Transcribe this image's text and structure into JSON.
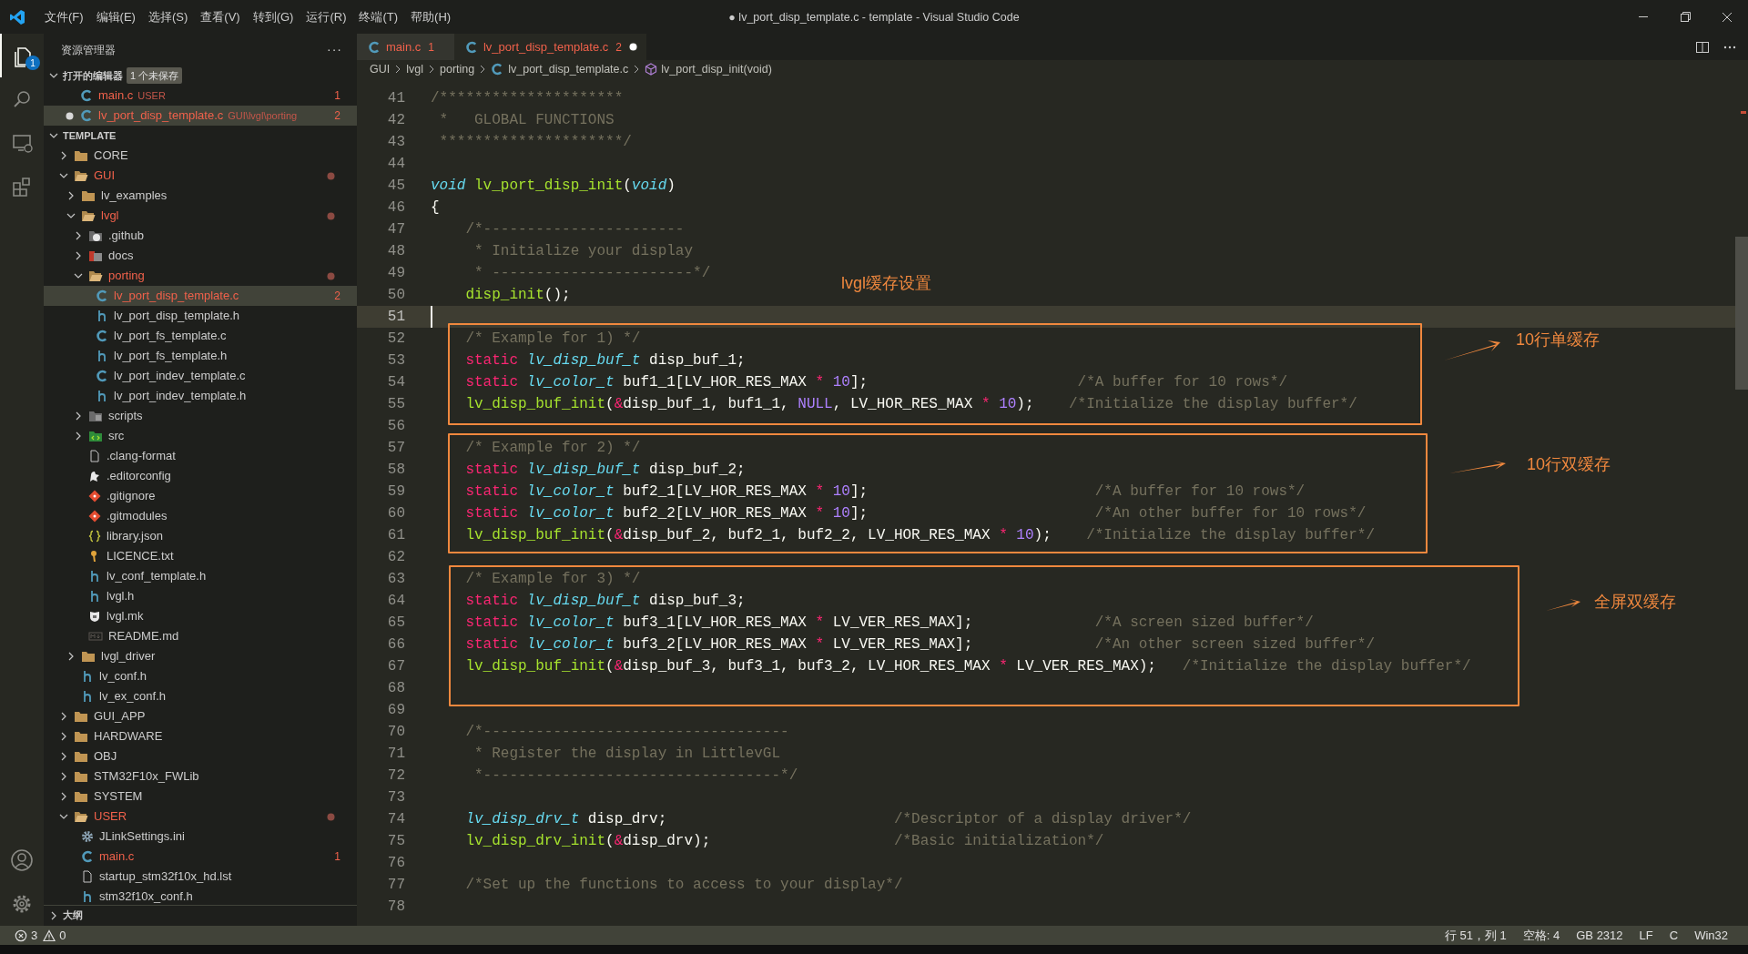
{
  "title_bar": {
    "menu": [
      "文件(F)",
      "编辑(E)",
      "选择(S)",
      "查看(V)",
      "转到(G)",
      "运行(R)",
      "终端(T)",
      "帮助(H)"
    ],
    "title": "● lv_port_disp_template.c - template - Visual Studio Code"
  },
  "activity_bar": {
    "explorer_badge": "1"
  },
  "sidebar": {
    "title": "资源管理器",
    "more": "···",
    "open_editors": {
      "label": "打开的编辑器",
      "expanded": true,
      "unsaved_badge": "1 个未保存",
      "items": [
        {
          "name": "main.c",
          "path": "USER",
          "badge": "1",
          "modified": false,
          "selected": false
        },
        {
          "name": "lv_port_disp_template.c",
          "path": "GUI\\lvgl\\porting",
          "badge": "2",
          "modified": true,
          "selected": true
        }
      ]
    },
    "workspace": {
      "label": "TEMPLATE",
      "expanded": true,
      "items": [
        {
          "name": "CORE",
          "kind": "folder",
          "expanded": false,
          "error": false,
          "selected": false
        },
        {
          "name": "GUI",
          "kind": "folder",
          "expanded": true,
          "error": true,
          "selected": false,
          "children": [
            {
              "name": "lv_examples",
              "kind": "folder",
              "expanded": false,
              "error": false,
              "selected": false
            },
            {
              "name": "lvgl",
              "kind": "folder",
              "expanded": true,
              "error": true,
              "selected": false,
              "children": [
                {
                  "name": ".github",
                  "kind": "github",
                  "expanded": false,
                  "error": false,
                  "selected": false
                },
                {
                  "name": "docs",
                  "kind": "docs",
                  "expanded": false,
                  "error": false,
                  "selected": false
                },
                {
                  "name": "porting",
                  "kind": "folder",
                  "expanded": true,
                  "error": true,
                  "selected": false,
                  "children": [
                    {
                      "name": "lv_port_disp_template.c",
                      "kind": "c",
                      "error": true,
                      "badge": "2",
                      "selected": true
                    },
                    {
                      "name": "lv_port_disp_template.h",
                      "kind": "h",
                      "error": false,
                      "selected": false
                    },
                    {
                      "name": "lv_port_fs_template.c",
                      "kind": "c",
                      "error": false,
                      "selected": false
                    },
                    {
                      "name": "lv_port_fs_template.h",
                      "kind": "h",
                      "error": false,
                      "selected": false
                    },
                    {
                      "name": "lv_port_indev_template.c",
                      "kind": "c",
                      "error": false,
                      "selected": false
                    },
                    {
                      "name": "lv_port_indev_template.h",
                      "kind": "h",
                      "error": false,
                      "selected": false
                    }
                  ]
                },
                {
                  "name": "scripts",
                  "kind": "scripts",
                  "expanded": false,
                  "error": false,
                  "selected": false
                },
                {
                  "name": "src",
                  "kind": "src",
                  "expanded": false,
                  "error": false,
                  "selected": false
                },
                {
                  "name": ".clang-format",
                  "kind": "file",
                  "error": false,
                  "selected": false
                },
                {
                  "name": ".editorconfig",
                  "kind": "editorconfig",
                  "error": false,
                  "selected": false
                },
                {
                  "name": ".gitignore",
                  "kind": "git",
                  "error": false,
                  "selected": false
                },
                {
                  "name": ".gitmodules",
                  "kind": "git",
                  "error": false,
                  "selected": false
                },
                {
                  "name": "library.json",
                  "kind": "json",
                  "error": false,
                  "selected": false
                },
                {
                  "name": "LICENCE.txt",
                  "kind": "licence",
                  "error": false,
                  "selected": false
                },
                {
                  "name": "lv_conf_template.h",
                  "kind": "h",
                  "error": false,
                  "selected": false
                },
                {
                  "name": "lvgl.h",
                  "kind": "h",
                  "error": false,
                  "selected": false
                },
                {
                  "name": "lvgl.mk",
                  "kind": "mk",
                  "error": false,
                  "selected": false
                },
                {
                  "name": "README.md",
                  "kind": "md",
                  "error": false,
                  "selected": false
                }
              ]
            },
            {
              "name": "lvgl_driver",
              "kind": "folder",
              "expanded": false,
              "error": false,
              "selected": false
            },
            {
              "name": "lv_conf.h",
              "kind": "h",
              "error": false,
              "selected": false
            },
            {
              "name": "lv_ex_conf.h",
              "kind": "h",
              "error": false,
              "selected": false
            }
          ]
        },
        {
          "name": "GUI_APP",
          "kind": "folder",
          "expanded": false,
          "error": false,
          "selected": false
        },
        {
          "name": "HARDWARE",
          "kind": "folder",
          "expanded": false,
          "error": false,
          "selected": false
        },
        {
          "name": "OBJ",
          "kind": "folder",
          "expanded": false,
          "error": false,
          "selected": false
        },
        {
          "name": "STM32F10x_FWLib",
          "kind": "folder",
          "expanded": false,
          "error": false,
          "selected": false
        },
        {
          "name": "SYSTEM",
          "kind": "folder",
          "expanded": false,
          "error": false,
          "selected": false
        },
        {
          "name": "USER",
          "kind": "folder",
          "expanded": true,
          "error": true,
          "selected": false,
          "children": [
            {
              "name": "JLinkSettings.ini",
              "kind": "settings",
              "error": false,
              "selected": false
            },
            {
              "name": "main.c",
              "kind": "c",
              "error": true,
              "badge": "1",
              "selected": false
            },
            {
              "name": "startup_stm32f10x_hd.lst",
              "kind": "file",
              "error": false,
              "selected": false
            },
            {
              "name": "stm32f10x_conf.h",
              "kind": "h",
              "error": false,
              "selected": false
            }
          ]
        }
      ]
    },
    "outline": {
      "label": "大纲",
      "expanded": false
    }
  },
  "tabs": [
    {
      "name": "main.c",
      "badge": "1",
      "modified": false,
      "selected": false
    },
    {
      "name": "lv_port_disp_template.c",
      "badge": "2",
      "modified": true,
      "selected": true
    }
  ],
  "breadcrumb": [
    "GUI",
    "lvgl",
    "porting",
    "lv_port_disp_template.c",
    "lv_port_disp_init(void)"
  ],
  "code": [
    {
      "number": "41",
      "current": false,
      "tokens": [
        {
          "kind": "cm",
          "text": "/*********************"
        }
      ]
    },
    {
      "number": "42",
      "current": false,
      "tokens": [
        {
          "kind": "cm",
          "text": " *   GLOBAL FUNCTIONS"
        }
      ]
    },
    {
      "number": "43",
      "current": false,
      "tokens": [
        {
          "kind": "cm",
          "text": " *********************/"
        }
      ]
    },
    {
      "number": "44",
      "current": false
    },
    {
      "number": "45",
      "current": false,
      "tokens": [
        {
          "kind": "type",
          "text": "void"
        },
        {
          "kind": "fn",
          "text": " lv_port_disp_init"
        },
        {
          "kind": "p",
          "text": "("
        },
        {
          "kind": "type",
          "text": "void"
        },
        {
          "kind": "p",
          "text": ")"
        }
      ]
    },
    {
      "number": "46",
      "current": false,
      "tokens": [
        {
          "kind": "p",
          "text": "{"
        }
      ]
    },
    {
      "number": "47",
      "current": false,
      "tokens": [
        {
          "kind": "cm",
          "text": "    /*-----------------------"
        }
      ]
    },
    {
      "number": "48",
      "current": false,
      "tokens": [
        {
          "kind": "cm",
          "text": "     * Initialize your display"
        }
      ]
    },
    {
      "number": "49",
      "current": false,
      "tokens": [
        {
          "kind": "cm",
          "text": "     * -----------------------*/"
        }
      ]
    },
    {
      "number": "50",
      "current": false,
      "tokens": [
        {
          "kind": "fn",
          "text": "    disp_init"
        },
        {
          "kind": "p",
          "text": "();"
        }
      ]
    },
    {
      "number": "51",
      "current": true
    },
    {
      "number": "52",
      "current": false,
      "tokens": [
        {
          "kind": "cm",
          "text": "    /* Example for 1) */"
        }
      ]
    },
    {
      "number": "53",
      "current": false,
      "tokens": [
        {
          "kind": "kw",
          "text": "    static"
        },
        {
          "kind": "type",
          "text": " lv_disp_buf_t"
        },
        {
          "kind": "p",
          "text": " disp_buf_1;"
        }
      ]
    },
    {
      "number": "54",
      "current": false,
      "tokens": [
        {
          "kind": "kw",
          "text": "    static"
        },
        {
          "kind": "type",
          "text": " lv_color_t"
        },
        {
          "kind": "p",
          "text": " buf1_1[LV_HOR_RES_MAX "
        },
        {
          "kind": "op",
          "text": "*"
        },
        {
          "kind": "num",
          "text": " 10"
        },
        {
          "kind": "p",
          "text": "];"
        },
        {
          "kind": "cm",
          "text": "                        /*A buffer for 10 rows*/"
        }
      ]
    },
    {
      "number": "55",
      "current": false,
      "tokens": [
        {
          "kind": "fn",
          "text": "    lv_disp_buf_init"
        },
        {
          "kind": "p",
          "text": "("
        },
        {
          "kind": "op",
          "text": "&"
        },
        {
          "kind": "p",
          "text": "disp_buf_1, buf1_1, "
        },
        {
          "kind": "num",
          "text": "NULL"
        },
        {
          "kind": "p",
          "text": ", LV_HOR_RES_MAX "
        },
        {
          "kind": "op",
          "text": "*"
        },
        {
          "kind": "num",
          "text": " 10"
        },
        {
          "kind": "p",
          "text": ");"
        },
        {
          "kind": "cm",
          "text": "    /*Initialize the display buffer*/"
        }
      ]
    },
    {
      "number": "56",
      "current": false
    },
    {
      "number": "57",
      "current": false,
      "tokens": [
        {
          "kind": "cm",
          "text": "    /* Example for 2) */"
        }
      ]
    },
    {
      "number": "58",
      "current": false,
      "tokens": [
        {
          "kind": "kw",
          "text": "    static"
        },
        {
          "kind": "type",
          "text": " lv_disp_buf_t"
        },
        {
          "kind": "p",
          "text": " disp_buf_2;"
        }
      ]
    },
    {
      "number": "59",
      "current": false,
      "tokens": [
        {
          "kind": "kw",
          "text": "    static"
        },
        {
          "kind": "type",
          "text": " lv_color_t"
        },
        {
          "kind": "p",
          "text": " buf2_1[LV_HOR_RES_MAX "
        },
        {
          "kind": "op",
          "text": "*"
        },
        {
          "kind": "num",
          "text": " 10"
        },
        {
          "kind": "p",
          "text": "];"
        },
        {
          "kind": "cm",
          "text": "                          /*A buffer for 10 rows*/"
        }
      ]
    },
    {
      "number": "60",
      "current": false,
      "tokens": [
        {
          "kind": "kw",
          "text": "    static"
        },
        {
          "kind": "type",
          "text": " lv_color_t"
        },
        {
          "kind": "p",
          "text": " buf2_2[LV_HOR_RES_MAX "
        },
        {
          "kind": "op",
          "text": "*"
        },
        {
          "kind": "num",
          "text": " 10"
        },
        {
          "kind": "p",
          "text": "];"
        },
        {
          "kind": "cm",
          "text": "                          /*An other buffer for 10 rows*/"
        }
      ]
    },
    {
      "number": "61",
      "current": false,
      "tokens": [
        {
          "kind": "fn",
          "text": "    lv_disp_buf_init"
        },
        {
          "kind": "p",
          "text": "("
        },
        {
          "kind": "op",
          "text": "&"
        },
        {
          "kind": "p",
          "text": "disp_buf_2, buf2_1, buf2_2, LV_HOR_RES_MAX "
        },
        {
          "kind": "op",
          "text": "*"
        },
        {
          "kind": "num",
          "text": " 10"
        },
        {
          "kind": "p",
          "text": ");"
        },
        {
          "kind": "cm",
          "text": "    /*Initialize the display buffer*/"
        }
      ]
    },
    {
      "number": "62",
      "current": false
    },
    {
      "number": "63",
      "current": false,
      "tokens": [
        {
          "kind": "cm",
          "text": "    /* Example for 3) */"
        }
      ]
    },
    {
      "number": "64",
      "current": false,
      "tokens": [
        {
          "kind": "kw",
          "text": "    static"
        },
        {
          "kind": "type",
          "text": " lv_disp_buf_t"
        },
        {
          "kind": "p",
          "text": " disp_buf_3;"
        }
      ]
    },
    {
      "number": "65",
      "current": false,
      "tokens": [
        {
          "kind": "kw",
          "text": "    static"
        },
        {
          "kind": "type",
          "text": " lv_color_t"
        },
        {
          "kind": "p",
          "text": " buf3_1[LV_HOR_RES_MAX "
        },
        {
          "kind": "op",
          "text": "*"
        },
        {
          "kind": "p",
          "text": " LV_VER_RES_MAX];"
        },
        {
          "kind": "cm",
          "text": "              /*A screen sized buffer*/"
        }
      ]
    },
    {
      "number": "66",
      "current": false,
      "tokens": [
        {
          "kind": "kw",
          "text": "    static"
        },
        {
          "kind": "type",
          "text": " lv_color_t"
        },
        {
          "kind": "p",
          "text": " buf3_2[LV_HOR_RES_MAX "
        },
        {
          "kind": "op",
          "text": "*"
        },
        {
          "kind": "p",
          "text": " LV_VER_RES_MAX];"
        },
        {
          "kind": "cm",
          "text": "              /*An other screen sized buffer*/"
        }
      ]
    },
    {
      "number": "67",
      "current": false,
      "tokens": [
        {
          "kind": "fn",
          "text": "    lv_disp_buf_init"
        },
        {
          "kind": "p",
          "text": "("
        },
        {
          "kind": "op",
          "text": "&"
        },
        {
          "kind": "p",
          "text": "disp_buf_3, buf3_1, buf3_2, LV_HOR_RES_MAX "
        },
        {
          "kind": "op",
          "text": "*"
        },
        {
          "kind": "p",
          "text": " LV_VER_RES_MAX);"
        },
        {
          "kind": "cm",
          "text": "   /*Initialize the display buffer*/"
        }
      ]
    },
    {
      "number": "68",
      "current": false
    },
    {
      "number": "69",
      "current": false
    },
    {
      "number": "70",
      "current": false,
      "tokens": [
        {
          "kind": "cm",
          "text": "    /*-----------------------------------"
        }
      ]
    },
    {
      "number": "71",
      "current": false,
      "tokens": [
        {
          "kind": "cm",
          "text": "     * Register the display in LittlevGL"
        }
      ]
    },
    {
      "number": "72",
      "current": false,
      "tokens": [
        {
          "kind": "cm",
          "text": "     *----------------------------------*/"
        }
      ]
    },
    {
      "number": "73",
      "current": false
    },
    {
      "number": "74",
      "current": false,
      "tokens": [
        {
          "kind": "type",
          "text": "    lv_disp_drv_t"
        },
        {
          "kind": "p",
          "text": " disp_drv;"
        },
        {
          "kind": "cm",
          "text": "                          /*Descriptor of a display driver*/"
        }
      ]
    },
    {
      "number": "75",
      "current": false,
      "tokens": [
        {
          "kind": "fn",
          "text": "    lv_disp_drv_init"
        },
        {
          "kind": "p",
          "text": "("
        },
        {
          "kind": "op",
          "text": "&"
        },
        {
          "kind": "p",
          "text": "disp_drv);"
        },
        {
          "kind": "cm",
          "text": "                     /*Basic initialization*/"
        }
      ]
    },
    {
      "number": "76",
      "current": false
    },
    {
      "number": "77",
      "current": false,
      "tokens": [
        {
          "kind": "cm",
          "text": "    /*Set up the functions to access to your display*/"
        }
      ]
    },
    {
      "number": "78",
      "current": false
    }
  ],
  "annotations": {
    "heading": "lvgl缓存设置",
    "callouts": [
      {
        "label": "10行单缓存"
      },
      {
        "label": "10行双缓存"
      },
      {
        "label": "全屏双缓存"
      }
    ]
  },
  "status_bar": {
    "errors": "3",
    "warnings": "0",
    "items": [
      "行 51，列 1",
      "空格: 4",
      "GB 2312",
      "LF",
      "C",
      "Win32"
    ]
  }
}
